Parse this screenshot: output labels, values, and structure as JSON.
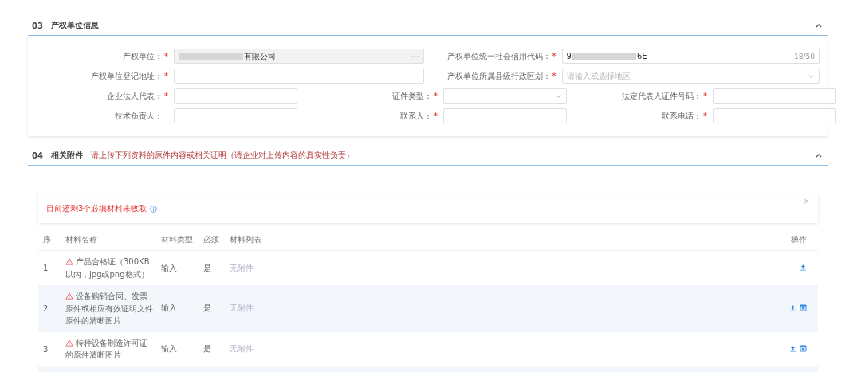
{
  "owner_section": {
    "number": "03",
    "title": "产权单位信息",
    "expanded": true,
    "rows": [
      [
        {
          "label": "产权单位：",
          "required_mark": "*",
          "kind": "disabled",
          "value_end": "有限公司",
          "more": "···"
        },
        {
          "label": "产权单位统一社会信用代码：",
          "required_mark": "*",
          "kind": "input",
          "value_start": "9",
          "value_end": "6E",
          "counter": "18/50"
        }
      ],
      [
        {
          "label": "产权单位登记地址：",
          "required_mark": "*",
          "kind": "input"
        },
        {
          "label": "产权单位所属县级行政区划：",
          "required_mark": "*",
          "kind": "select",
          "placeholder": "请输入或选择地区"
        }
      ],
      [
        {
          "label": "企业法人代表：",
          "required_mark": "*",
          "kind": "input"
        },
        {
          "label": "证件类型：",
          "required_mark": "*",
          "kind": "select"
        },
        {
          "label": "法定代表人证件号码：",
          "required_mark": "*",
          "kind": "input"
        }
      ],
      [
        {
          "label": "技术负责人：",
          "kind": "input"
        },
        {
          "label": "联系人：",
          "required_mark": "*",
          "kind": "input"
        },
        {
          "label": "联系电话：",
          "required_mark": "*",
          "kind": "input"
        }
      ]
    ]
  },
  "attachments_section": {
    "number": "04",
    "title": "相关附件",
    "note": "请上传下列资料的原件内容或相关证明（请企业对上传内容的真实性负责）",
    "expanded": true,
    "alert": {
      "text": "目前还剩3个必填材料未收取",
      "close": "×"
    },
    "table": {
      "columns": [
        "序",
        "材料名称",
        "材料类型",
        "必须",
        "材料列表",
        "操作"
      ],
      "rows": [
        {
          "index": "1",
          "name": "产品合格证（300KB以内，jpg或png格式）",
          "type": "输入",
          "required": "是",
          "files": "无附件",
          "actions": [
            {
              "kind": "upload"
            }
          ]
        },
        {
          "index": "2",
          "name": "设备购销合同、发票原件或相应有效证明文件原件的清晰图片",
          "type": "输入",
          "required": "是",
          "files": "无附件",
          "actions": [
            {
              "kind": "upload"
            },
            {
              "kind": "preview"
            }
          ]
        },
        {
          "index": "3",
          "name": "特种设备制造许可证的原件清晰图片",
          "type": "输入",
          "required": "是",
          "files": "无附件",
          "actions": [
            {
              "kind": "upload"
            },
            {
              "kind": "preview"
            }
          ]
        }
      ]
    }
  }
}
